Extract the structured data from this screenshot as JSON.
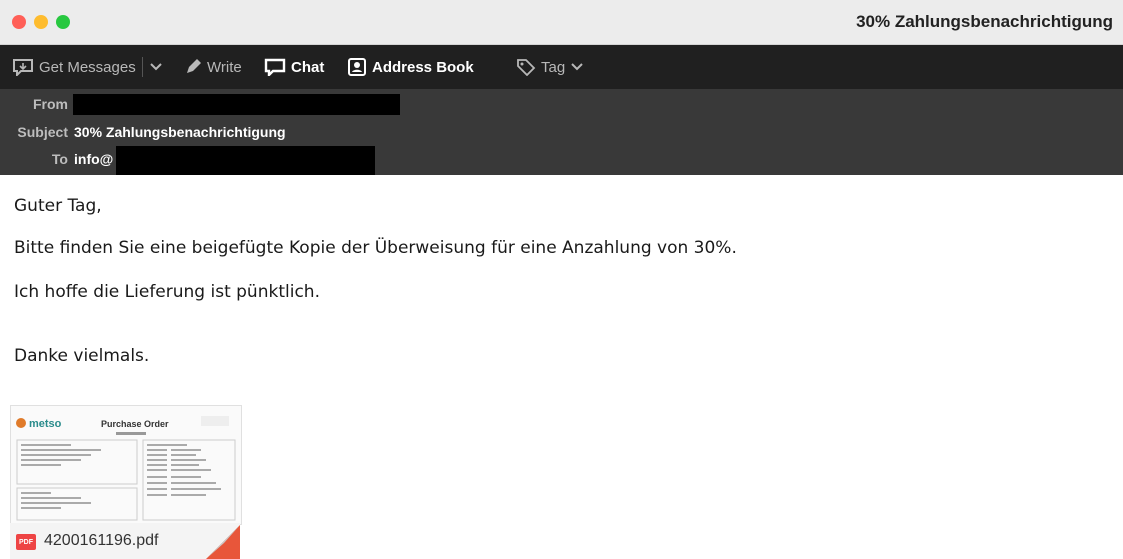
{
  "window": {
    "title": "30% Zahlungsbenachrichtigung"
  },
  "toolbar": {
    "get_messages": "Get Messages",
    "write": "Write",
    "chat": "Chat",
    "address_book": "Address Book",
    "tag": "Tag"
  },
  "headers": {
    "from_label": "From",
    "subject_label": "Subject",
    "subject_value": "30% Zahlungsbenachrichtigung",
    "to_label": "To",
    "to_value": "info@"
  },
  "message": {
    "lines": [
      "Guter Tag,",
      "Bitte finden Sie eine beigefügte Kopie der Überweisung für eine Anzahlung von 30%.",
      "Ich hoffe die Lieferung ist pünktlich.",
      "Danke vielmals."
    ]
  },
  "attachment": {
    "file_name": "4200161196.pdf",
    "badge": "PDF",
    "preview": {
      "brand": "metso",
      "doc_title": "Purchase Order"
    }
  },
  "colors": {
    "titlebar_bg": "#ececec",
    "toolbar_bg": "#202020",
    "header_bg": "#393939",
    "close": "#ff5f57",
    "minimize": "#febc2e",
    "zoom": "#28c840"
  }
}
